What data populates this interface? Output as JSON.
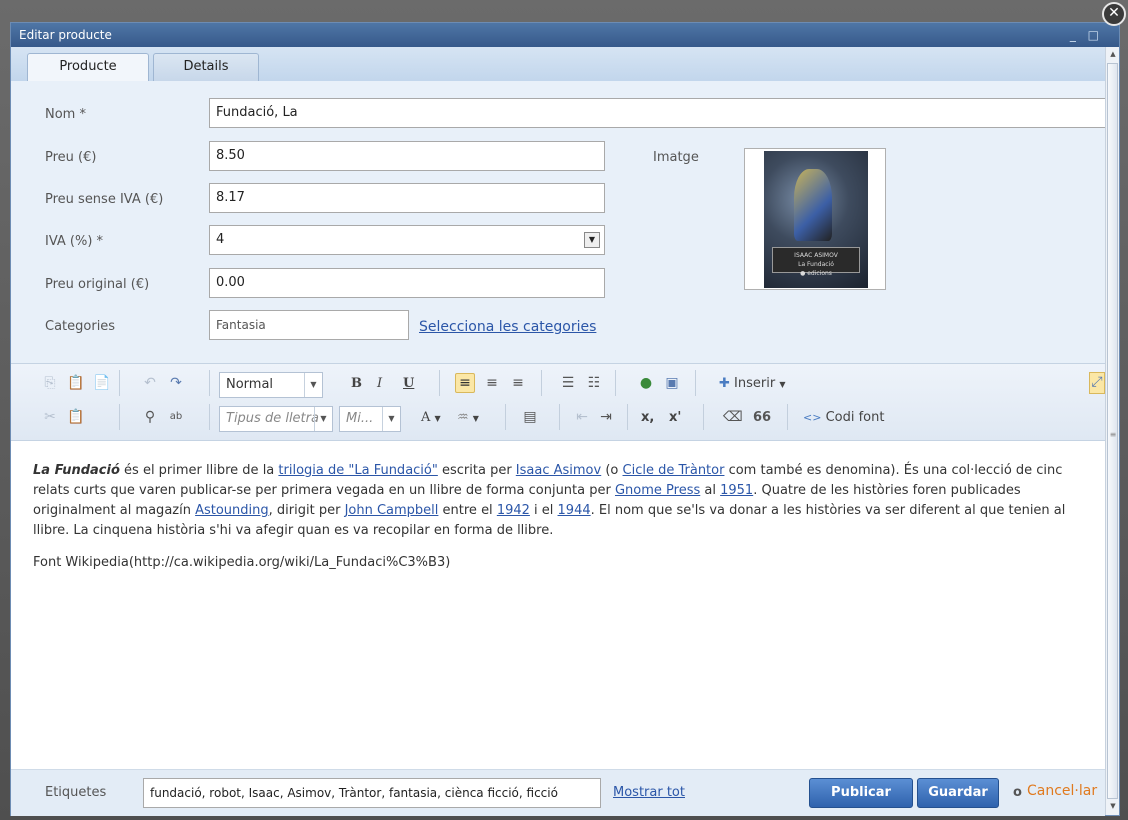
{
  "window": {
    "title": "Editar producte",
    "controls": "_ □"
  },
  "tabs": [
    {
      "label": "Producte",
      "active": true
    },
    {
      "label": "Details",
      "active": false
    }
  ],
  "form": {
    "nom_label": "Nom *",
    "nom_value": "Fundació, La",
    "preu_label": "Preu (€)",
    "preu_value": "8.50",
    "preu_sense_iva_label": "Preu sense IVA (€)",
    "preu_sense_iva_value": "8.17",
    "iva_label": "IVA (%) *",
    "iva_value": "4",
    "preu_original_label": "Preu original (€)",
    "preu_original_value": "0.00",
    "categories_label": "Categories",
    "categories_value": "Fantasia",
    "select_categories_link": "Selecciona les categories",
    "imatge_label": "Imatge"
  },
  "cover": {
    "author": "ISAAC ASIMOV",
    "title": "La Fundació",
    "publisher": "● edicions"
  },
  "toolbar": {
    "format_value": "Normal",
    "font_placeholder": "Tipus de lletra",
    "size_placeholder": "Mi...",
    "insert_label": "Inserir",
    "source_label": "Codi font",
    "bold": "B",
    "italic": "I",
    "underline": "U",
    "subscript": "x,",
    "superscript": "x'",
    "quote": "66",
    "font_color": "A"
  },
  "editor": {
    "p1": {
      "t0": "La Fundació",
      "t1": " és el primer llibre de la ",
      "l1": "trilogia de \"La Fundació\"",
      "t2": " escrita per ",
      "l2": "Isaac Asimov",
      "t3": " (o ",
      "l3": "Cicle de Tràntor",
      "t4": " com també es denomina). És una col·lecció de cinc relats curts que varen publicar-se per primera vegada en un llibre de forma conjunta per ",
      "l4": "Gnome Press",
      "t5": " al ",
      "l5": "1951",
      "t6": ". Quatre de les històries foren publicades originalment al magazín ",
      "l6": "Astounding",
      "t7": ", dirigit per ",
      "l7": "John Campbell",
      "t8": " entre el ",
      "l8": "1942",
      "t9": " i el ",
      "l9": "1944",
      "t10": ". El nom que se'ls va donar a les històries va ser diferent al que tenien al llibre. La cinquena història s'hi va afegir quan es va recopilar en forma de llibre."
    },
    "p2": "Font Wikipedia(http://ca.wikipedia.org/wiki/La_Fundaci%C3%B3)"
  },
  "footer": {
    "etiquetes_label": "Etiquetes",
    "etiquetes_value": "fundació, robot, Isaac, Asimov, Tràntor,  fantasia, ciènca ficció, ficció",
    "mostrar_tot": "Mostrar tot",
    "publicar": "Publicar",
    "guardar": "Guardar",
    "o": "o",
    "cancel": "Cancel·lar"
  },
  "colors": {
    "titlebar": "#3f6699",
    "primary_button": "#2f62ad",
    "link": "#2b56a8",
    "cancel_link": "#e07a1f"
  }
}
